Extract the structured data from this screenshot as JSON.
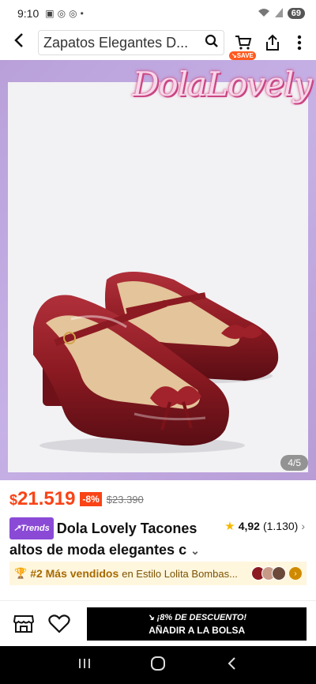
{
  "status": {
    "time": "9:10",
    "battery": "69"
  },
  "search": {
    "query": "Zapatos Elegantes D..."
  },
  "cart": {
    "badge": "SAVE"
  },
  "hero": {
    "brand": "DolaLovely",
    "page_indicator": "4/5"
  },
  "price": {
    "currency": "$",
    "amount": "21.519",
    "discount": "-8%",
    "original": "$23.390"
  },
  "product": {
    "trend_badge": "Trends",
    "title_line1": "Dola Lovely Tacones",
    "title_line2": "altos de moda elegantes c",
    "rating": "4,92",
    "reviews": "(1.130)"
  },
  "ranking": {
    "rank": "#2 Más vendidos",
    "category": "en Estilo Lolita Bombas..."
  },
  "actions": {
    "promo": "¡8% DE DESCUENTO!",
    "add_to_bag": "AÑADIR A LA BOLSA"
  },
  "colors": {
    "accent": "#fa4316",
    "trends": "#8a4ad6",
    "hero_bg": "#c3abe3",
    "shoe": "#8c1a22"
  }
}
